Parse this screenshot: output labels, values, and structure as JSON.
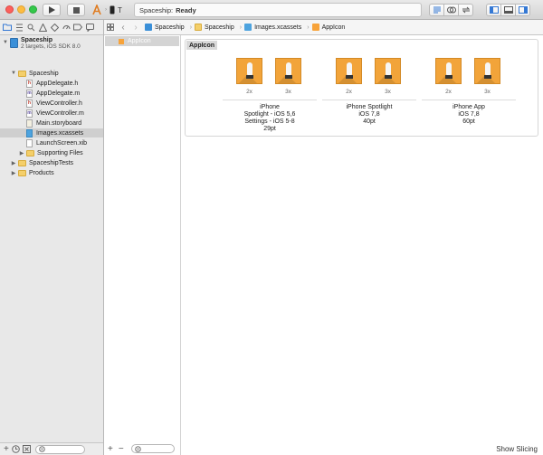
{
  "toolbar": {
    "scheme_device": "T",
    "status_project": "Spaceship:",
    "status_text": "Ready"
  },
  "navigator": {
    "project_name": "Spaceship",
    "project_sub": "2 targets, iOS SDK 8.0",
    "items": [
      {
        "label": "Spaceship",
        "kind": "folder"
      },
      {
        "label": "AppDelegate.h",
        "kind": "h"
      },
      {
        "label": "AppDelegate.m",
        "kind": "m"
      },
      {
        "label": "ViewController.h",
        "kind": "h"
      },
      {
        "label": "ViewController.m",
        "kind": "m"
      },
      {
        "label": "Main.storyboard",
        "kind": "storyboard"
      },
      {
        "label": "Images.xcassets",
        "kind": "xcassets",
        "selected": true
      },
      {
        "label": "LaunchScreen.xib",
        "kind": "xib"
      },
      {
        "label": "Supporting Files",
        "kind": "folder"
      },
      {
        "label": "SpaceshipTests",
        "kind": "folder"
      },
      {
        "label": "Products",
        "kind": "folder"
      }
    ]
  },
  "jumpbar": {
    "crumbs": [
      "Spaceship",
      "Spaceship",
      "Images.xcassets",
      "AppIcon"
    ]
  },
  "asset_list": {
    "items": [
      {
        "label": "AppIcon"
      }
    ]
  },
  "asset_catalog": {
    "set_title": "AppIcon",
    "groups": [
      {
        "label_lines": [
          "iPhone",
          "Spotlight - iOS 5,6",
          "Settings - iOS 5-8",
          "29pt"
        ],
        "scales": [
          "2x",
          "3x"
        ]
      },
      {
        "label_lines": [
          "iPhone Spotlight",
          "iOS 7,8",
          "40pt"
        ],
        "scales": [
          "2x",
          "3x"
        ]
      },
      {
        "label_lines": [
          "iPhone App",
          "iOS 7,8",
          "60pt"
        ],
        "scales": [
          "2x",
          "3x"
        ]
      }
    ]
  },
  "footer": {
    "show_slicing": "Show Slicing"
  }
}
